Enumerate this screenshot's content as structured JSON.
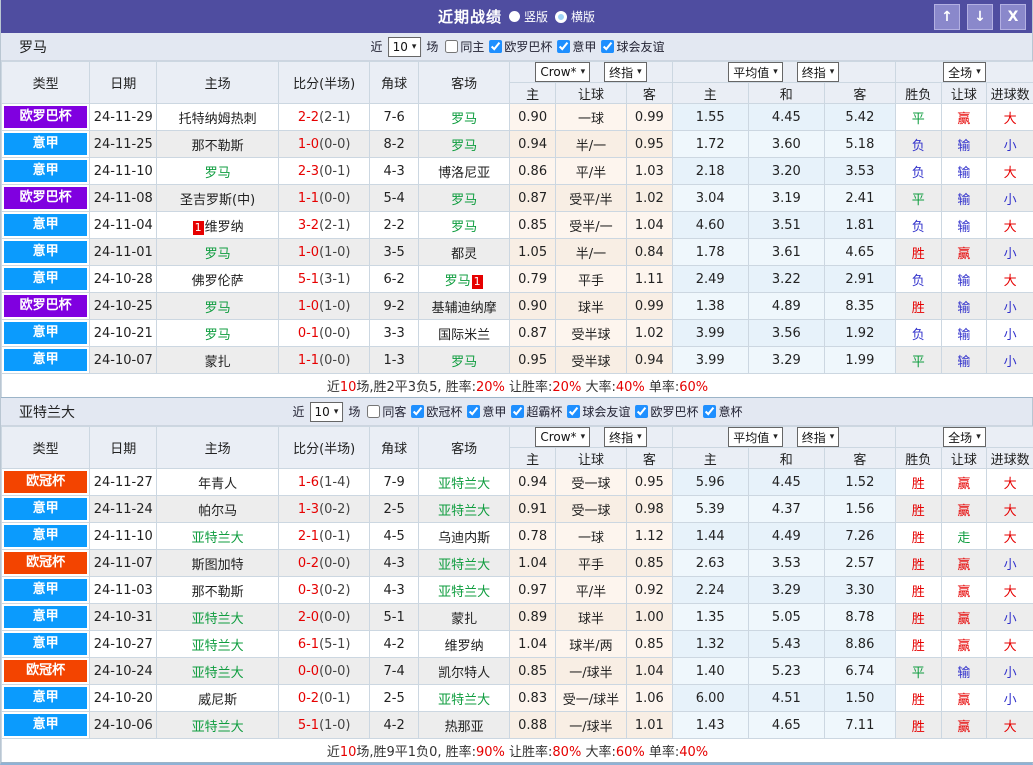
{
  "titlebar": {
    "title": "近期战绩",
    "radios": [
      {
        "label": "竖版",
        "selected": false
      },
      {
        "label": "横版",
        "selected": true
      }
    ],
    "buttons": {
      "up": "↑",
      "down": "↓",
      "close": "X"
    }
  },
  "colors": {
    "titlebar_bg": "#4f4da0",
    "button_bg": "#8a88cb",
    "focus_team_green": "#0f9d3f",
    "score_red": "#e60000",
    "leagues": {
      "欧罗巴杯": "#8000e0",
      "意甲": "#0b9bfd",
      "欧冠杯": "#f34400"
    },
    "results": {
      "胜": "red",
      "赢": "red",
      "大": "red",
      "平": "green",
      "走": "green",
      "负": "blue",
      "输": "blue",
      "小": "blue"
    }
  },
  "columns": {
    "main": [
      "类型",
      "日期",
      "主场",
      "比分(半场)",
      "角球",
      "客场"
    ],
    "crow_selects": [
      "Crow*",
      "终指"
    ],
    "avg_selects": [
      "平均值",
      "终指"
    ],
    "full_select": "全场",
    "crow_sub": [
      "主",
      "让球",
      "客"
    ],
    "avg_sub": [
      "主",
      "和",
      "客"
    ],
    "full_sub": [
      "胜负",
      "让球",
      "进球数"
    ]
  },
  "tables": [
    {
      "team": "罗马",
      "filter": {
        "prefix": "近",
        "count": "10",
        "suffix": "场",
        "same": {
          "label": "同主",
          "checked": false
        },
        "leagues": [
          {
            "label": "欧罗巴杯",
            "checked": true
          },
          {
            "label": "意甲",
            "checked": true
          },
          {
            "label": "球会友谊",
            "checked": true
          }
        ]
      },
      "rows": [
        {
          "league": "欧罗巴杯",
          "date": "24-11-29",
          "home": {
            "name": "托特纳姆热刺"
          },
          "ft": "2-2",
          "ht": "(2-1)",
          "corner": "7-6",
          "away": {
            "name": "罗马",
            "focus": true
          },
          "crow": [
            "0.90",
            "一球",
            "0.99"
          ],
          "avg": [
            "1.55",
            "4.45",
            "5.42"
          ],
          "full": [
            "平",
            "赢",
            "大"
          ]
        },
        {
          "league": "意甲",
          "date": "24-11-25",
          "home": {
            "name": "那不勒斯"
          },
          "ft": "1-0",
          "ht": "(0-0)",
          "corner": "8-2",
          "away": {
            "name": "罗马",
            "focus": true
          },
          "crow": [
            "0.94",
            "半/一",
            "0.95"
          ],
          "avg": [
            "1.72",
            "3.60",
            "5.18"
          ],
          "full": [
            "负",
            "输",
            "小"
          ]
        },
        {
          "league": "意甲",
          "date": "24-11-10",
          "home": {
            "name": "罗马",
            "focus": true
          },
          "ft": "2-3",
          "ht": "(0-1)",
          "corner": "4-3",
          "away": {
            "name": "博洛尼亚"
          },
          "crow": [
            "0.86",
            "平/半",
            "1.03"
          ],
          "avg": [
            "2.18",
            "3.20",
            "3.53"
          ],
          "full": [
            "负",
            "输",
            "大"
          ]
        },
        {
          "league": "欧罗巴杯",
          "date": "24-11-08",
          "home": {
            "name": "圣吉罗斯(中)"
          },
          "ft": "1-1",
          "ht": "(0-0)",
          "corner": "5-4",
          "away": {
            "name": "罗马",
            "focus": true
          },
          "crow": [
            "0.87",
            "受平/半",
            "1.02"
          ],
          "avg": [
            "3.04",
            "3.19",
            "2.41"
          ],
          "full": [
            "平",
            "输",
            "小"
          ]
        },
        {
          "league": "意甲",
          "date": "24-11-04",
          "home": {
            "name": "维罗纳",
            "badge": "1",
            "badge_side": "left"
          },
          "ft": "3-2",
          "ht": "(2-1)",
          "corner": "2-2",
          "away": {
            "name": "罗马",
            "focus": true
          },
          "crow": [
            "0.85",
            "受半/一",
            "1.04"
          ],
          "avg": [
            "4.60",
            "3.51",
            "1.81"
          ],
          "full": [
            "负",
            "输",
            "大"
          ]
        },
        {
          "league": "意甲",
          "date": "24-11-01",
          "home": {
            "name": "罗马",
            "focus": true
          },
          "ft": "1-0",
          "ht": "(1-0)",
          "corner": "3-5",
          "away": {
            "name": "都灵"
          },
          "crow": [
            "1.05",
            "半/一",
            "0.84"
          ],
          "avg": [
            "1.78",
            "3.61",
            "4.65"
          ],
          "full": [
            "胜",
            "赢",
            "小"
          ]
        },
        {
          "league": "意甲",
          "date": "24-10-28",
          "home": {
            "name": "佛罗伦萨"
          },
          "ft": "5-1",
          "ht": "(3-1)",
          "corner": "6-2",
          "away": {
            "name": "罗马",
            "focus": true,
            "badge": "1",
            "badge_side": "right"
          },
          "crow": [
            "0.79",
            "平手",
            "1.11"
          ],
          "avg": [
            "2.49",
            "3.22",
            "2.91"
          ],
          "full": [
            "负",
            "输",
            "大"
          ]
        },
        {
          "league": "欧罗巴杯",
          "date": "24-10-25",
          "home": {
            "name": "罗马",
            "focus": true
          },
          "ft": "1-0",
          "ht": "(1-0)",
          "corner": "9-2",
          "away": {
            "name": "基辅迪纳摩"
          },
          "crow": [
            "0.90",
            "球半",
            "0.99"
          ],
          "avg": [
            "1.38",
            "4.89",
            "8.35"
          ],
          "full": [
            "胜",
            "输",
            "小"
          ]
        },
        {
          "league": "意甲",
          "date": "24-10-21",
          "home": {
            "name": "罗马",
            "focus": true
          },
          "ft": "0-1",
          "ht": "(0-0)",
          "corner": "3-3",
          "away": {
            "name": "国际米兰"
          },
          "crow": [
            "0.87",
            "受半球",
            "1.02"
          ],
          "avg": [
            "3.99",
            "3.56",
            "1.92"
          ],
          "full": [
            "负",
            "输",
            "小"
          ]
        },
        {
          "league": "意甲",
          "date": "24-10-07",
          "home": {
            "name": "蒙扎"
          },
          "ft": "1-1",
          "ht": "(0-0)",
          "corner": "1-3",
          "away": {
            "name": "罗马",
            "focus": true
          },
          "crow": [
            "0.95",
            "受半球",
            "0.94"
          ],
          "avg": [
            "3.99",
            "3.29",
            "1.99"
          ],
          "full": [
            "平",
            "输",
            "小"
          ]
        }
      ],
      "summary": [
        {
          "t": "近"
        },
        {
          "t": "10",
          "red": true
        },
        {
          "t": "场,胜2平3负5, 胜率:"
        },
        {
          "t": "20%",
          "red": true
        },
        {
          "t": " 让胜率:"
        },
        {
          "t": "20%",
          "red": true
        },
        {
          "t": " 大率:"
        },
        {
          "t": "40%",
          "red": true
        },
        {
          "t": " 单率:"
        },
        {
          "t": "60%",
          "red": true
        }
      ]
    },
    {
      "team": "亚特兰大",
      "filter": {
        "prefix": "近",
        "count": "10",
        "suffix": "场",
        "same": {
          "label": "同客",
          "checked": false
        },
        "leagues": [
          {
            "label": "欧冠杯",
            "checked": true
          },
          {
            "label": "意甲",
            "checked": true
          },
          {
            "label": "超霸杯",
            "checked": true
          },
          {
            "label": "球会友谊",
            "checked": true
          },
          {
            "label": "欧罗巴杯",
            "checked": true
          },
          {
            "label": "意杯",
            "checked": true
          }
        ]
      },
      "rows": [
        {
          "league": "欧冠杯",
          "date": "24-11-27",
          "home": {
            "name": "年青人"
          },
          "ft": "1-6",
          "ht": "(1-4)",
          "corner": "7-9",
          "away": {
            "name": "亚特兰大",
            "focus": true
          },
          "crow": [
            "0.94",
            "受一球",
            "0.95"
          ],
          "avg": [
            "5.96",
            "4.45",
            "1.52"
          ],
          "full": [
            "胜",
            "赢",
            "大"
          ]
        },
        {
          "league": "意甲",
          "date": "24-11-24",
          "home": {
            "name": "帕尔马"
          },
          "ft": "1-3",
          "ht": "(0-2)",
          "corner": "2-5",
          "away": {
            "name": "亚特兰大",
            "focus": true
          },
          "crow": [
            "0.91",
            "受一球",
            "0.98"
          ],
          "avg": [
            "5.39",
            "4.37",
            "1.56"
          ],
          "full": [
            "胜",
            "赢",
            "大"
          ]
        },
        {
          "league": "意甲",
          "date": "24-11-10",
          "home": {
            "name": "亚特兰大",
            "focus": true
          },
          "ft": "2-1",
          "ht": "(0-1)",
          "corner": "4-5",
          "away": {
            "name": "乌迪内斯"
          },
          "crow": [
            "0.78",
            "一球",
            "1.12"
          ],
          "avg": [
            "1.44",
            "4.49",
            "7.26"
          ],
          "full": [
            "胜",
            "走",
            "大"
          ]
        },
        {
          "league": "欧冠杯",
          "date": "24-11-07",
          "home": {
            "name": "斯图加特"
          },
          "ft": "0-2",
          "ht": "(0-0)",
          "corner": "4-3",
          "away": {
            "name": "亚特兰大",
            "focus": true
          },
          "crow": [
            "1.04",
            "平手",
            "0.85"
          ],
          "avg": [
            "2.63",
            "3.53",
            "2.57"
          ],
          "full": [
            "胜",
            "赢",
            "小"
          ]
        },
        {
          "league": "意甲",
          "date": "24-11-03",
          "home": {
            "name": "那不勒斯"
          },
          "ft": "0-3",
          "ht": "(0-2)",
          "corner": "4-3",
          "away": {
            "name": "亚特兰大",
            "focus": true
          },
          "crow": [
            "0.97",
            "平/半",
            "0.92"
          ],
          "avg": [
            "2.24",
            "3.29",
            "3.30"
          ],
          "full": [
            "胜",
            "赢",
            "大"
          ]
        },
        {
          "league": "意甲",
          "date": "24-10-31",
          "home": {
            "name": "亚特兰大",
            "focus": true
          },
          "ft": "2-0",
          "ht": "(0-0)",
          "corner": "5-1",
          "away": {
            "name": "蒙扎"
          },
          "crow": [
            "0.89",
            "球半",
            "1.00"
          ],
          "avg": [
            "1.35",
            "5.05",
            "8.78"
          ],
          "full": [
            "胜",
            "赢",
            "小"
          ]
        },
        {
          "league": "意甲",
          "date": "24-10-27",
          "home": {
            "name": "亚特兰大",
            "focus": true
          },
          "ft": "6-1",
          "ht": "(5-1)",
          "corner": "4-2",
          "away": {
            "name": "维罗纳"
          },
          "crow": [
            "1.04",
            "球半/两",
            "0.85"
          ],
          "avg": [
            "1.32",
            "5.43",
            "8.86"
          ],
          "full": [
            "胜",
            "赢",
            "大"
          ]
        },
        {
          "league": "欧冠杯",
          "date": "24-10-24",
          "home": {
            "name": "亚特兰大",
            "focus": true
          },
          "ft": "0-0",
          "ht": "(0-0)",
          "corner": "7-4",
          "away": {
            "name": "凯尔特人"
          },
          "crow": [
            "0.85",
            "一/球半",
            "1.04"
          ],
          "avg": [
            "1.40",
            "5.23",
            "6.74"
          ],
          "full": [
            "平",
            "输",
            "小"
          ]
        },
        {
          "league": "意甲",
          "date": "24-10-20",
          "home": {
            "name": "威尼斯"
          },
          "ft": "0-2",
          "ht": "(0-1)",
          "corner": "2-5",
          "away": {
            "name": "亚特兰大",
            "focus": true
          },
          "crow": [
            "0.83",
            "受一/球半",
            "1.06"
          ],
          "avg": [
            "6.00",
            "4.51",
            "1.50"
          ],
          "full": [
            "胜",
            "赢",
            "小"
          ]
        },
        {
          "league": "意甲",
          "date": "24-10-06",
          "home": {
            "name": "亚特兰大",
            "focus": true
          },
          "ft": "5-1",
          "ht": "(1-0)",
          "corner": "4-2",
          "away": {
            "name": "热那亚"
          },
          "crow": [
            "0.88",
            "一/球半",
            "1.01"
          ],
          "avg": [
            "1.43",
            "4.65",
            "7.11"
          ],
          "full": [
            "胜",
            "赢",
            "大"
          ]
        }
      ],
      "summary": [
        {
          "t": "近"
        },
        {
          "t": "10",
          "red": true
        },
        {
          "t": "场,胜9平1负0, 胜率:"
        },
        {
          "t": "90%",
          "red": true
        },
        {
          "t": " 让胜率:"
        },
        {
          "t": "80%",
          "red": true
        },
        {
          "t": " 大率:"
        },
        {
          "t": "60%",
          "red": true
        },
        {
          "t": " 单率:"
        },
        {
          "t": "40%",
          "red": true
        }
      ]
    }
  ]
}
